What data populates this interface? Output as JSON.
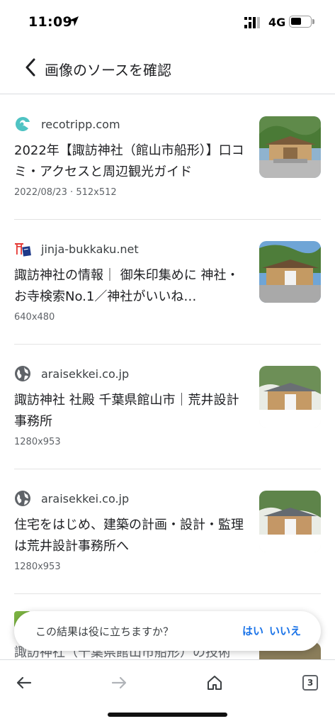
{
  "status_bar": {
    "time": "11:09",
    "network": "4G",
    "battery_level": 0.55
  },
  "header": {
    "title": "画像のソースを確認"
  },
  "results": [
    {
      "source": "recotripp.com",
      "icon": "recotripp-logo-icon",
      "title": "2022年【諏訪神社（館山市船形）】口コミ・アクセスと周辺観光ガイド",
      "meta": "2022/08/23 · 512x512"
    },
    {
      "source": "jinja-bukkaku.net",
      "icon": "torii-logo-icon",
      "title": "諏訪神社の情報｜ 御朱印集めに 神社・お寺検索No.1／神社がいいね…",
      "meta": "640x480"
    },
    {
      "source": "araisekkei.co.jp",
      "icon": "globe-icon",
      "title": "諏訪神社 社殿 千葉県館山市｜荒井設計事務所",
      "meta": "1280x953"
    },
    {
      "source": "araisekkei.co.jp",
      "icon": "globe-icon",
      "title": "住宅をはじめ、建築の計画・設計・監理は荒井設計事務所へ",
      "meta": "1280x953"
    }
  ],
  "peek": {
    "title": "諏訪神社（千葉県館山市船形）の技術"
  },
  "feedback": {
    "question": "この結果は役に立ちますか？",
    "yes": "はい",
    "no": "いいえ"
  },
  "toolbar": {
    "tab_count": "3"
  },
  "colors": {
    "accent": "#1a73e8",
    "recotripp": "#4fc3c3",
    "torii": "#e53935"
  }
}
